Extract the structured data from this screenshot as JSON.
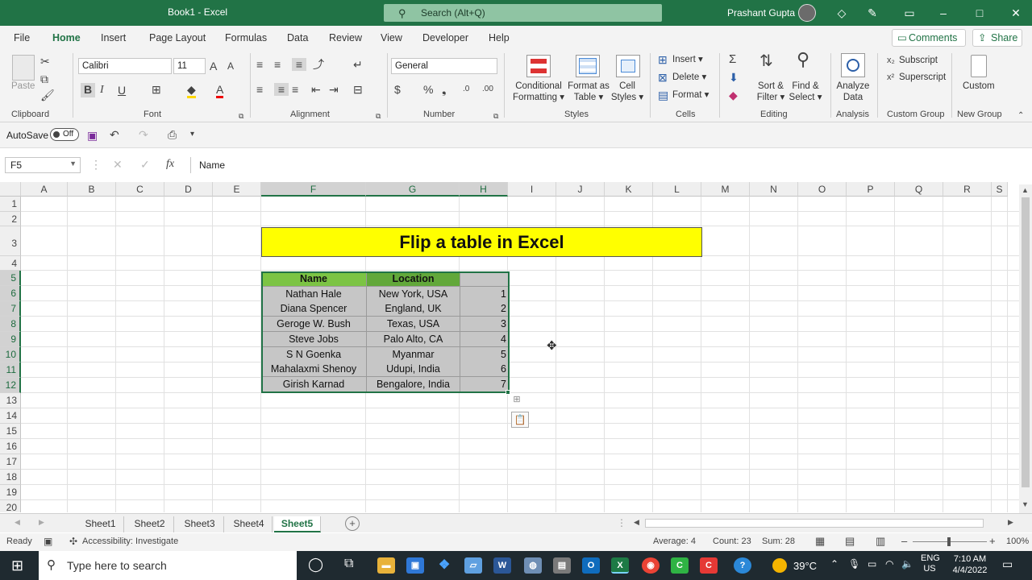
{
  "titlebar": {
    "title": "Book1  -  Excel",
    "search_placeholder": "Search (Alt+Q)",
    "user": "Prashant Gupta"
  },
  "tabs": [
    "File",
    "Home",
    "Insert",
    "Page Layout",
    "Formulas",
    "Data",
    "Review",
    "View",
    "Developer",
    "Help"
  ],
  "active_tab": "Home",
  "comments_label": "Comments",
  "share_label": "Share",
  "ribbon": {
    "clipboard": {
      "label": "Clipboard",
      "paste": "Paste"
    },
    "font": {
      "label": "Font",
      "name": "Calibri",
      "size": "11"
    },
    "alignment": {
      "label": "Alignment"
    },
    "number": {
      "label": "Number",
      "format": "General"
    },
    "styles": {
      "label": "Styles",
      "conditional": "Conditional",
      "conditional2": "Formatting",
      "format_as": "Format as",
      "format_as2": "Table",
      "cell": "Cell",
      "cell2": "Styles"
    },
    "cells": {
      "label": "Cells",
      "insert": "Insert",
      "delete": "Delete",
      "format": "Format"
    },
    "editing": {
      "label": "Editing",
      "sort": "Sort &",
      "sort2": "Filter",
      "find": "Find &",
      "find2": "Select"
    },
    "analysis": {
      "label": "Analysis",
      "analyze": "Analyze",
      "analyze2": "Data"
    },
    "custom_group": {
      "label": "Custom Group",
      "subscript": "Subscript",
      "superscript": "Superscript"
    },
    "new_group": {
      "label": "New Group",
      "custom": "Custom"
    }
  },
  "qat": {
    "autosave": "AutoSave",
    "toggle": "Off"
  },
  "formula_bar": {
    "namebox": "F5",
    "fx": "fx",
    "content": "Name"
  },
  "columns": [
    "A",
    "B",
    "C",
    "D",
    "E",
    "F",
    "G",
    "H",
    "I",
    "J",
    "K",
    "L",
    "M",
    "N",
    "O",
    "P",
    "Q",
    "R",
    "S"
  ],
  "rows": [
    "1",
    "2",
    "3",
    "4",
    "5",
    "6",
    "7",
    "8",
    "9",
    "10",
    "11",
    "12",
    "13",
    "14",
    "15",
    "16",
    "17",
    "18",
    "19",
    "20"
  ],
  "sheet_title": "Flip a table in Excel",
  "table": {
    "headers": [
      "Name",
      "Location",
      ""
    ],
    "rows": [
      [
        "Nathan Hale",
        "New York, USA",
        "1"
      ],
      [
        "Diana Spencer",
        "England, UK",
        "2"
      ],
      [
        "Geroge W. Bush",
        "Texas, USA",
        "3"
      ],
      [
        "Steve Jobs",
        "Palo Alto, CA",
        "4"
      ],
      [
        "S N Goenka",
        "Myanmar",
        "5"
      ],
      [
        "Mahalaxmi Shenoy",
        "Udupi, India",
        "6"
      ],
      [
        "Girish Karnad",
        "Bengalore, India",
        "7"
      ]
    ]
  },
  "sheet_tabs": [
    "Sheet1",
    "Sheet2",
    "Sheet3",
    "Sheet4",
    "Sheet5"
  ],
  "active_sheet": "Sheet5",
  "status": {
    "ready": "Ready",
    "accessibility": "Accessibility: Investigate",
    "average": "Average: 4",
    "count": "Count: 23",
    "sum": "Sum: 28",
    "zoom": "100%"
  },
  "taskbar": {
    "search_placeholder": "Type here to search",
    "temperature": "39°C",
    "lang1": "ENG",
    "lang2": "US",
    "time": "7:10 AM",
    "date": "4/4/2022"
  },
  "colors": {
    "excel_green": "#217346",
    "title_fill": "#ffff00",
    "header_fill": "#7cc444",
    "body_fill": "#c6c6c6"
  }
}
